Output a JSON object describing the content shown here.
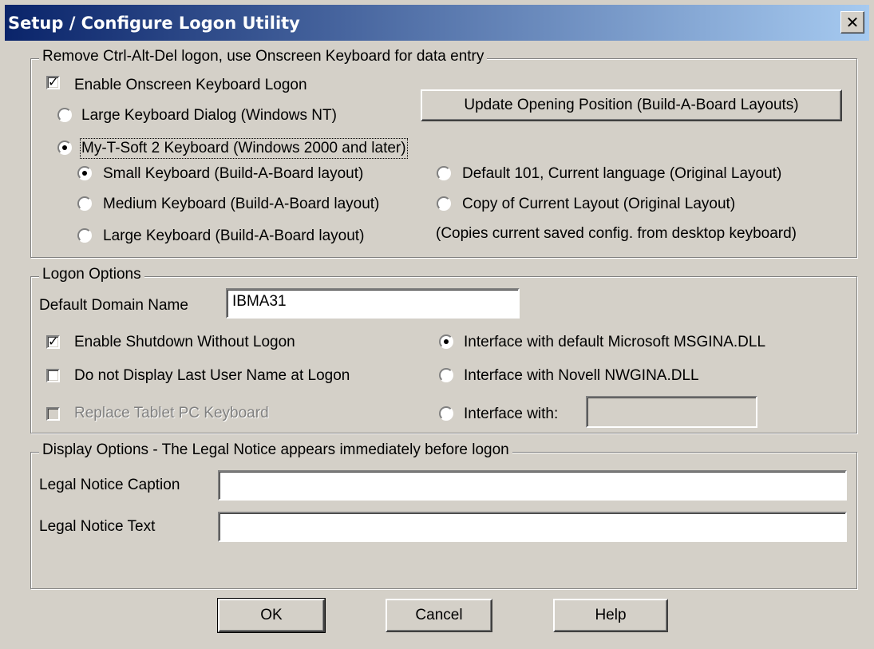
{
  "title": "Setup / Configure Logon Utility",
  "close_label": "✕",
  "onscreen": {
    "legend": "Remove Ctrl-Alt-Del logon, use Onscreen Keyboard for data entry",
    "enable": "Enable Onscreen Keyboard Logon",
    "large_dialog": "Large Keyboard Dialog (Windows NT)",
    "update_button": "Update Opening Position (Build-A-Board Layouts)",
    "mytsoft": "My-T-Soft 2 Keyboard (Windows 2000 and later)",
    "small": "Small Keyboard (Build-A-Board layout)",
    "medium": "Medium Keyboard (Build-A-Board layout)",
    "large": "Large Keyboard (Build-A-Board layout)",
    "default101": "Default 101, Current language (Original Layout)",
    "copy_current": "Copy of Current Layout (Original Layout)",
    "copy_note": "(Copies current saved config. from desktop keyboard)"
  },
  "logon": {
    "legend": "Logon Options",
    "domain_label": "Default Domain Name",
    "domain_value": "IBMA31",
    "shutdown": "Enable Shutdown Without Logon",
    "no_last_user": "Do not Display Last User Name at Logon",
    "tablet": "Replace Tablet PC Keyboard",
    "msgina": "Interface with default Microsoft MSGINA.DLL",
    "nwgina": "Interface with Novell NWGINA.DLL",
    "other": "Interface with:",
    "other_value": ""
  },
  "display": {
    "legend": "Display Options - The Legal Notice appears immediately before logon",
    "caption_label": "Legal Notice Caption",
    "caption_value": "",
    "text_label": "Legal Notice Text",
    "text_value": ""
  },
  "buttons": {
    "ok": "OK",
    "cancel": "Cancel",
    "help": "Help"
  }
}
